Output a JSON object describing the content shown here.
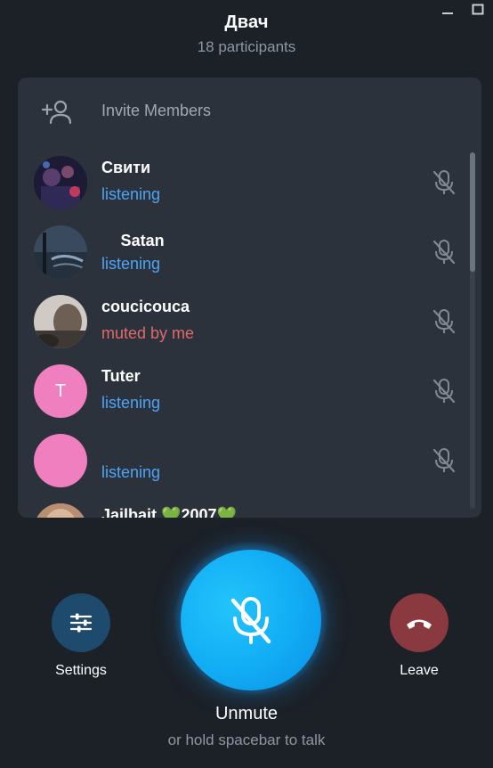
{
  "window": {
    "minimize_icon": "minimize-icon",
    "maximize_icon": "maximize-icon"
  },
  "header": {
    "title": "Двач",
    "subtitle": "18 participants"
  },
  "invite": {
    "label": "Invite Members",
    "icon": "add-user-icon"
  },
  "participants": [
    {
      "name": "Свити",
      "status": "listening",
      "status_kind": "listening",
      "avatar": "photo",
      "avatar_bg": "#2a2440",
      "initial": ""
    },
    {
      "name": "ㅤ Satan",
      "status": "listening",
      "status_kind": "listening",
      "avatar": "photo",
      "avatar_bg": "#2e3b4c",
      "initial": ""
    },
    {
      "name": "coucicouca",
      "status": "muted by me",
      "status_kind": "muted",
      "avatar": "photo",
      "avatar_bg": "#4c4540",
      "initial": ""
    },
    {
      "name": "Tuter",
      "status": "listening",
      "status_kind": "listening",
      "avatar": "initial",
      "avatar_bg": "#ef7fbf",
      "initial": "T"
    },
    {
      "name": "",
      "status": "listening",
      "status_kind": "listening",
      "avatar": "initial",
      "avatar_bg": "#ef7fbf",
      "initial": ""
    },
    {
      "name": "Jailbait 💚2007💚",
      "status": "",
      "status_kind": "listening",
      "avatar": "photo",
      "avatar_bg": "#c9a88e",
      "initial": ""
    }
  ],
  "controls": {
    "settings_label": "Settings",
    "leave_label": "Leave",
    "unmute_label": "Unmute",
    "hint": "or hold spacebar to talk"
  },
  "colors": {
    "background": "#1c2128",
    "panel": "#2c323b",
    "listening": "#4ea4f6",
    "muted": "#e06a6a",
    "settings_button": "#1e4a6e",
    "leave_button": "#8a3a3f",
    "mic_button": "#12aef5"
  }
}
